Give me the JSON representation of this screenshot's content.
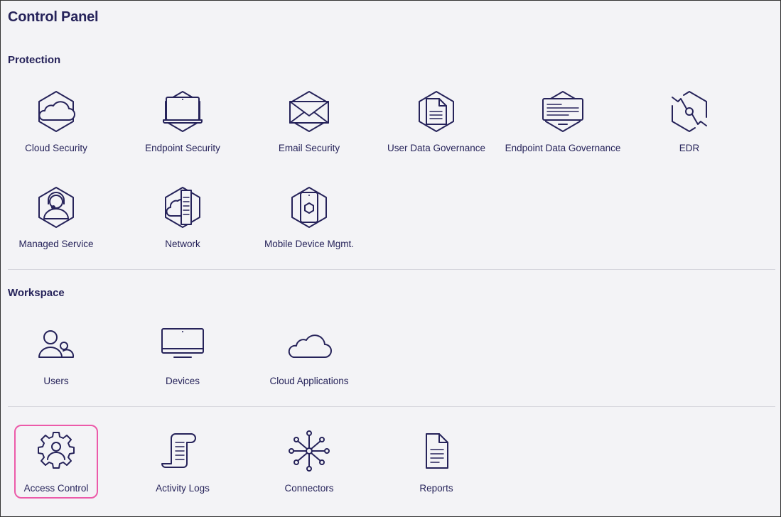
{
  "page": {
    "title": "Control Panel"
  },
  "protection": {
    "title": "Protection",
    "items": [
      {
        "label": "Cloud Security",
        "icon": "cloud-hex-icon"
      },
      {
        "label": "Endpoint Security",
        "icon": "laptop-hex-icon"
      },
      {
        "label": "Email Security",
        "icon": "envelope-hex-icon"
      },
      {
        "label": "User Data Governance",
        "icon": "document-hex-icon"
      },
      {
        "label": "Endpoint Data Governance",
        "icon": "monitor-document-hex-icon"
      },
      {
        "label": "EDR",
        "icon": "edr-hex-icon"
      },
      {
        "label": "Managed Service",
        "icon": "headset-agent-hex-icon"
      },
      {
        "label": "Network",
        "icon": "cloud-server-hex-icon"
      },
      {
        "label": "Mobile Device Mgmt.",
        "icon": "mobile-hex-icon"
      }
    ]
  },
  "workspace": {
    "title": "Workspace",
    "items": [
      {
        "label": "Users",
        "icon": "users-icon"
      },
      {
        "label": "Devices",
        "icon": "monitor-icon"
      },
      {
        "label": "Cloud Applications",
        "icon": "cloud-icon"
      }
    ]
  },
  "admin": {
    "items": [
      {
        "label": "Access Control",
        "icon": "user-gear-icon",
        "selected": true
      },
      {
        "label": "Activity Logs",
        "icon": "scroll-log-icon"
      },
      {
        "label": "Connectors",
        "icon": "network-hub-icon"
      },
      {
        "label": "Reports",
        "icon": "report-document-icon"
      }
    ]
  },
  "colors": {
    "text": "#26235a",
    "background": "#f3f3f6",
    "selection": "#ec5aa9",
    "divider": "#d7d7de"
  }
}
